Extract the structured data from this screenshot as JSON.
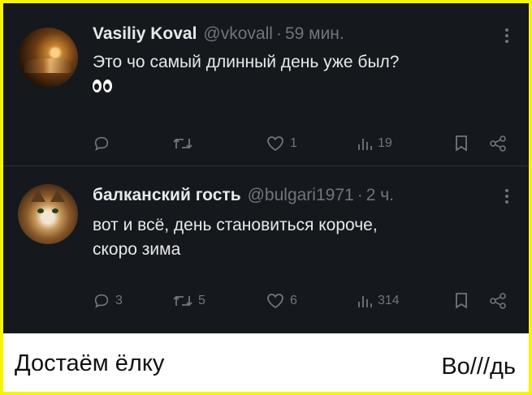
{
  "tweets": [
    {
      "name": "Vasiliy Koval",
      "handle": "@vkovall",
      "separator": "·",
      "time": "59 мин.",
      "lines": [
        "Это чо самый длинный день уже был?"
      ],
      "emoji": "eyes-icon",
      "avatar": "avatar-photo-candles",
      "actions": {
        "reply": "",
        "retweet": "",
        "like": "1",
        "views": "19"
      }
    },
    {
      "name": "балканский гость",
      "handle": "@bulgari1971",
      "separator": "·",
      "time": "2 ч.",
      "lines": [
        "вот и всё, день становиться короче,",
        "скоро зима"
      ],
      "avatar": "avatar-photo-cat",
      "actions": {
        "reply": "3",
        "retweet": "5",
        "like": "6",
        "views": "314"
      }
    }
  ],
  "caption": {
    "left": "Достаём ёлку",
    "right": "Во///дь"
  },
  "colors": {
    "frame_border": "#f5f500",
    "tweet_background": "#15181c",
    "primary_text": "#e7e9ea",
    "secondary_text": "#71767b",
    "caption_background": "#ffffff"
  }
}
